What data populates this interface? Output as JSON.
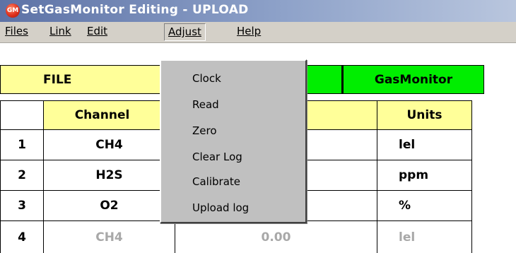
{
  "window": {
    "app_icon_text": "GM",
    "title": "SetGasMonitor Editing - UPLOAD"
  },
  "menubar": {
    "items": [
      {
        "label": "Files"
      },
      {
        "label": "Link"
      },
      {
        "label": "Edit"
      },
      {
        "label": "Adjust"
      },
      {
        "label": "Help"
      }
    ]
  },
  "header_strip": {
    "file_label": "FILE",
    "gasmonitor_label": "GasMonitor"
  },
  "table": {
    "headers": {
      "channel": "Channel",
      "units": "Units"
    },
    "rows": [
      {
        "num": "1",
        "channel": "CH4",
        "value": "",
        "units": "lel",
        "dimmed": false
      },
      {
        "num": "2",
        "channel": "H2S",
        "value": "",
        "units": "ppm",
        "dimmed": false
      },
      {
        "num": "3",
        "channel": "O2",
        "value": "",
        "units": "%",
        "dimmed": false
      },
      {
        "num": "4",
        "channel": "CH4",
        "value": "0.00",
        "units": "lel",
        "dimmed": true
      }
    ]
  },
  "adjust_menu": {
    "items": [
      {
        "label": "Clock"
      },
      {
        "label": "Read"
      },
      {
        "label": "Zero"
      },
      {
        "label": "Clear Log"
      },
      {
        "label": "Calibrate"
      },
      {
        "label": "Upload log"
      }
    ]
  }
}
